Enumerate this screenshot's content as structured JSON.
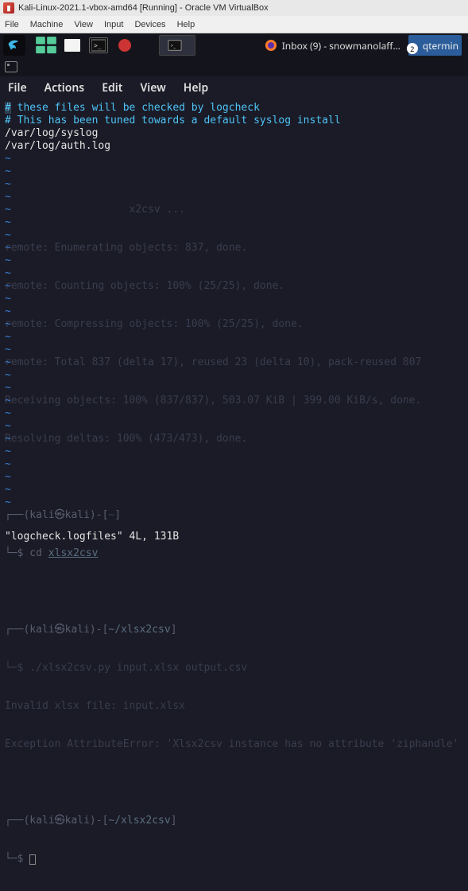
{
  "vbox": {
    "title": "Kali-Linux-2021.1-vbox-amd64 [Running] - Oracle VM VirtualBox",
    "menu": [
      "File",
      "Machine",
      "View",
      "Input",
      "Devices",
      "Help"
    ]
  },
  "panel": {
    "active_task_label": "",
    "inbox_label": "Inbox (9) - snowmanolaff…",
    "badge_count": "2",
    "right_label": "qtermin"
  },
  "term": {
    "menu": [
      "File",
      "Actions",
      "Edit",
      "View",
      "Help"
    ],
    "lines": {
      "l1_hash": "#",
      "l1_rest": " these files will be checked by logcheck",
      "l2": "# This has been tuned towards a default syslog install",
      "l3": "/var/log/syslog",
      "l4": "/var/log/auth.log"
    },
    "ghost": {
      "g1": "                    x2csv ...",
      "g2": "remote: Enumerating objects: 837, done.",
      "g3": "remote: Counting objects: 100% (25/25), done.",
      "g4": "remote: Compressing objects: 100% (25/25), done.",
      "g5": "remote: Total 837 (delta 17), reused 23 (delta 10), pack-reused 807",
      "g6": "Receiving objects: 100% (837/837), 503.07 KiB | 399.00 KiB/s, done.",
      "g7": "Resolving deltas: 100% (473/473), done.",
      "g8": "",
      "g9_p1": "┌──(kali㉿kali)-[",
      "g9_p2": "~",
      "g9_p3": "]",
      "g10_p1": "└─$ cd ",
      "g10_p2": "xlsx2csv",
      "g11": "",
      "g12_p1": "┌──(kali㉿kali)-[",
      "g12_p2": "~/xlsx2csv",
      "g12_p3": "]",
      "g13": "└─$ ./xlsx2csv.py input.xlsx output.csv",
      "g14": "Invalid xlsx file: input.xlsx",
      "g15": "Exception AttributeError: 'Xlsx2csv instance has no attribute 'ziphandle'",
      "g16": "",
      "g17_p1": "┌──(kali㉿kali)-[",
      "g17_p2": "~/xlsx2csv",
      "g17_p3": "]",
      "g18": "└─$ "
    },
    "tildes": [
      "~",
      "~",
      "~",
      "~",
      "~",
      "~",
      "~",
      "~",
      "~",
      "~",
      "~",
      "~",
      "~",
      "~",
      "~",
      "~",
      "~",
      "~",
      "~",
      "~",
      "~",
      "~",
      "~",
      "~",
      "~",
      "~",
      "~",
      "~"
    ],
    "status": "\"logcheck.logfiles\" 4L, 131B"
  }
}
